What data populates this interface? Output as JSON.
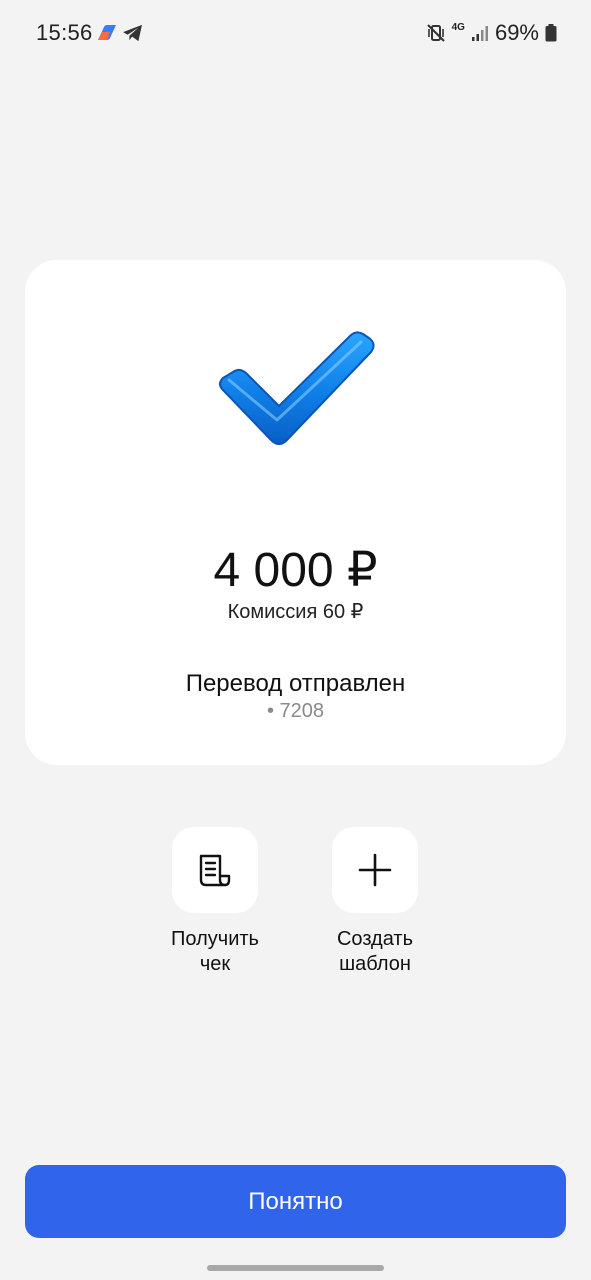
{
  "status_bar": {
    "time": "15:56",
    "icons": [
      "app-logo-icon",
      "telegram-icon",
      "vibrate-mute-icon",
      "4g-data-icon",
      "signal-icon",
      "battery-icon"
    ],
    "network": "4G",
    "battery": "69%"
  },
  "result": {
    "amount": "4 000 ₽",
    "commission": "Комиссия 60 ₽",
    "title": "Перевод отправлен",
    "account": "• 7208",
    "icon": "checkmark-icon",
    "accent_color": "#1a8af0"
  },
  "actions": [
    {
      "label": "Получить\nчек",
      "icon": "receipt-icon"
    },
    {
      "label": "Создать\nшаблон",
      "icon": "plus-icon"
    }
  ],
  "primary_button": {
    "label": "Понятно",
    "color": "#2f64eb"
  }
}
